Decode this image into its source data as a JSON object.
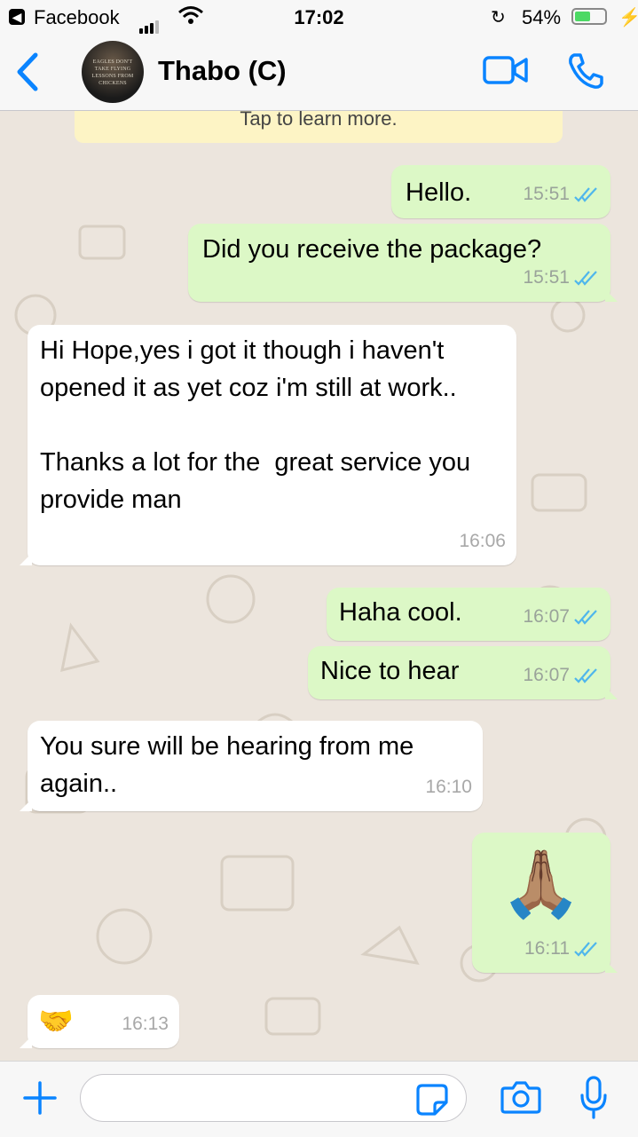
{
  "status_bar": {
    "back_app": "Facebook",
    "time": "17:02",
    "battery_percent": "54%",
    "battery_level": 0.54
  },
  "header": {
    "contact_name": "Thabo (C)",
    "avatar_text": "EAGLES DON'T TAKE FLYING LESSONS FROM CHICKENS",
    "accent_color": "#0a84ff"
  },
  "chat": {
    "notice_text": "Tap to learn more.",
    "messages": [
      {
        "direction": "outgoing",
        "text": "Hello.",
        "time": "15:51",
        "status": "read"
      },
      {
        "direction": "outgoing",
        "text": "Did you receive the package?",
        "time": "15:51",
        "status": "read"
      },
      {
        "direction": "incoming",
        "text": "Hi Hope,yes i got it though i haven't opened it as yet coz i'm still at work..\n\nThanks a lot for the  great service you provide man",
        "time": "16:06"
      },
      {
        "direction": "outgoing",
        "text": "Haha cool.",
        "time": "16:07",
        "status": "read"
      },
      {
        "direction": "outgoing",
        "text": "Nice to hear",
        "time": "16:07",
        "status": "read"
      },
      {
        "direction": "incoming",
        "text": "You sure will be hearing from me again..",
        "time": "16:10"
      },
      {
        "direction": "outgoing",
        "text": "🙏🏽",
        "time": "16:11",
        "status": "read",
        "emoji_name": "folded-hands"
      },
      {
        "direction": "incoming",
        "text": "🤝",
        "time": "16:13",
        "emoji_name": "handshake"
      }
    ]
  },
  "input": {
    "placeholder": ""
  },
  "colors": {
    "outgoing_bubble": "#dcf8c6",
    "incoming_bubble": "#ffffff",
    "chat_background": "#ece5dd",
    "read_ticks": "#4fb6ec"
  }
}
